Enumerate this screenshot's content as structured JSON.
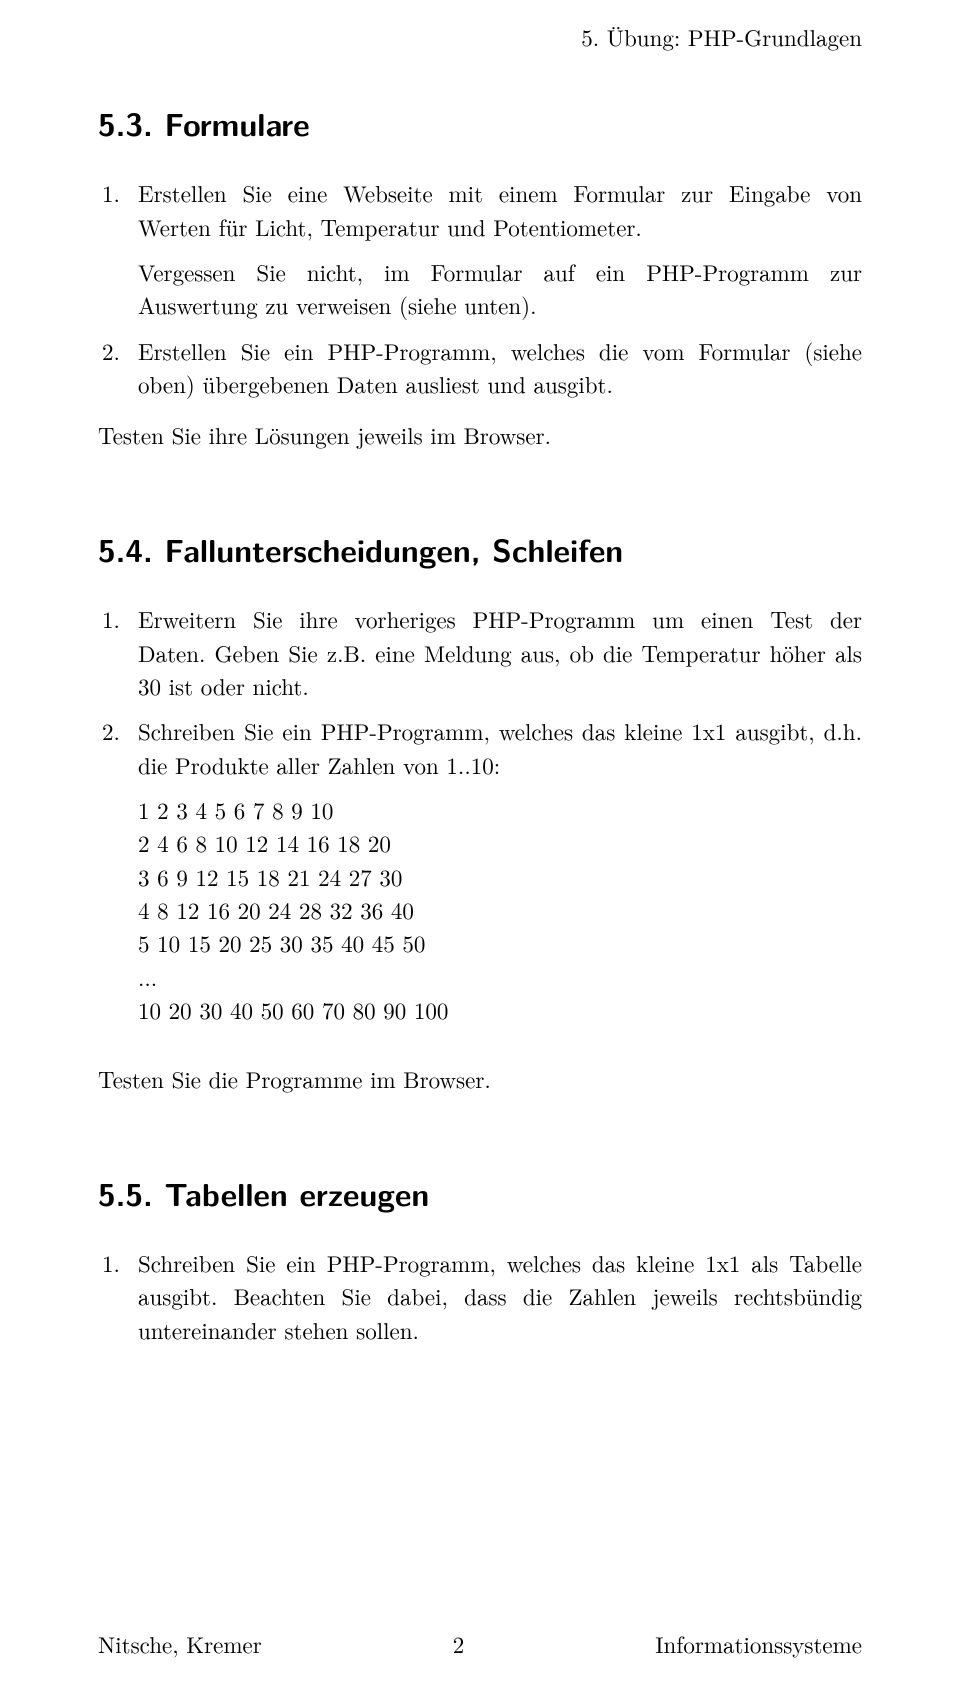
{
  "header": {
    "right": "5. Übung: PHP-Grundlagen"
  },
  "section53": {
    "heading": "5.3. Formulare",
    "items": [
      {
        "num": "1.",
        "text": "Erstellen Sie eine Webseite mit einem Formular zur Eingabe von Werten für Licht, Temperatur und Potentiometer."
      },
      {
        "num": "",
        "text": "Vergessen Sie nicht, im Formular auf ein PHP-Programm zur Auswertung zu verweisen (siehe unten)."
      },
      {
        "num": "2.",
        "text": "Erstellen Sie ein PHP-Programm, welches die vom Formular (siehe oben) übergebenen Daten ausliest und ausgibt."
      }
    ],
    "after": "Testen Sie ihre Lösungen jeweils im Browser."
  },
  "section54": {
    "heading": "5.4. Fallunterscheidungen, Schleifen",
    "items": [
      {
        "num": "1.",
        "text": "Erweitern Sie ihre vorheriges PHP-Programm um einen Test der Daten. Geben Sie z.B. eine Meldung aus, ob die Temperatur höher als 30 ist oder nicht."
      },
      {
        "num": "2.",
        "text": "Schreiben Sie ein PHP-Programm, welches das kleine 1x1 ausgibt, d.h. die Produkte aller Zahlen von 1..10:"
      }
    ],
    "code_rows": [
      "1 2 3 4 5 6 7 8 9 10",
      "2 4 6 8 10 12 14 16 18 20",
      "3 6 9 12 15 18 21 24 27 30",
      "4 8 12 16 20 24 28 32 36 40",
      "5 10 15 20 25 30 35 40 45 50",
      "...",
      "10 20 30 40 50 60 70 80 90 100"
    ],
    "after": "Testen Sie die Programme im Browser."
  },
  "section55": {
    "heading": "5.5. Tabellen erzeugen",
    "items": [
      {
        "num": "1.",
        "text": "Schreiben Sie ein PHP-Programm, welches das kleine 1x1 als Tabelle ausgibt. Beachten Sie dabei, dass die Zahlen jeweils rechtsbündig untereinander stehen sollen."
      }
    ]
  },
  "footer": {
    "left": "Nitsche, Kremer",
    "center": "2",
    "right": "Informationssysteme"
  }
}
